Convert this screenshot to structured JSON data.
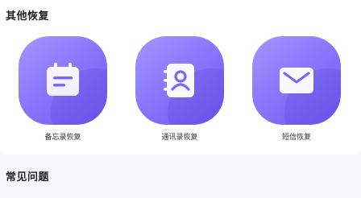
{
  "other_recovery": {
    "title": "其他恢复",
    "items": [
      {
        "label": "备忘录恢复",
        "icon": "memo-icon"
      },
      {
        "label": "通讯录恢复",
        "icon": "contacts-book-icon"
      },
      {
        "label": "短信恢复",
        "icon": "envelope-icon"
      }
    ]
  },
  "faq": {
    "title": "常见问题"
  },
  "colors": {
    "tile_gradient_start": "#a496ff",
    "tile_gradient_end": "#6c58ee",
    "page_background": "#f6f7fb"
  }
}
